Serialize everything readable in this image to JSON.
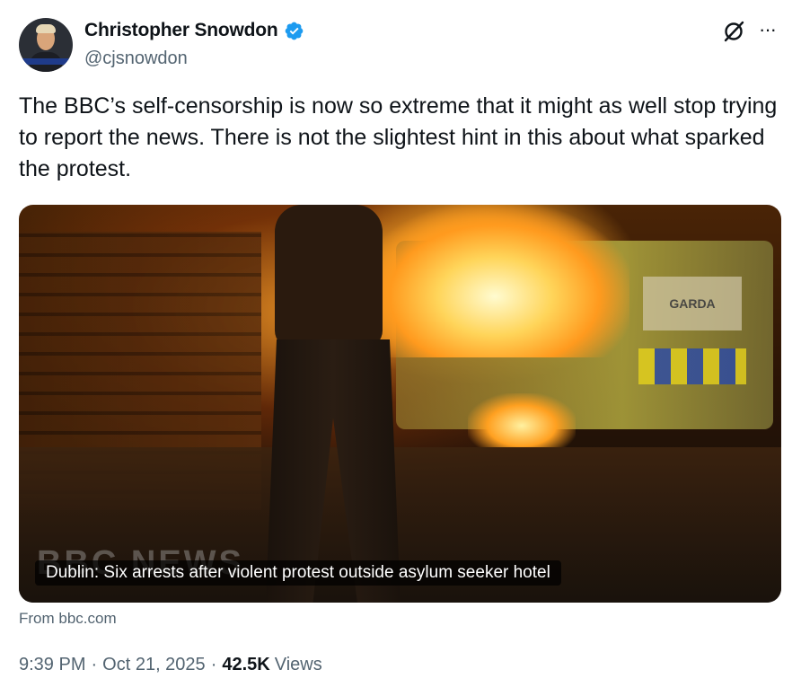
{
  "author": {
    "display_name": "Christopher Snowdon",
    "handle": "@cjsnowdon",
    "verified_icon": "verified-badge-icon",
    "verified_color": "#1d9bf0"
  },
  "header_actions": {
    "grok_icon": "grok-icon",
    "more_label": "···"
  },
  "tweet": {
    "text": "The BBC’s self-censorship is now so extreme that it might as well stop trying to report the news. There is not the slightest hint in this about what sparked the protest."
  },
  "link_card": {
    "caption": "Dublin: Six arrests after violent protest outside asylum seeker hotel",
    "watermark": "BBC NEWS",
    "van_label": "GARDA",
    "source": "From bbc.com"
  },
  "meta": {
    "time": "9:39 PM",
    "separator": "·",
    "date": "Oct 21, 2025",
    "views_count": "42.5K",
    "views_label": "Views"
  },
  "colors": {
    "text_primary": "#0f1419",
    "text_secondary": "#536471",
    "accent": "#1d9bf0"
  }
}
